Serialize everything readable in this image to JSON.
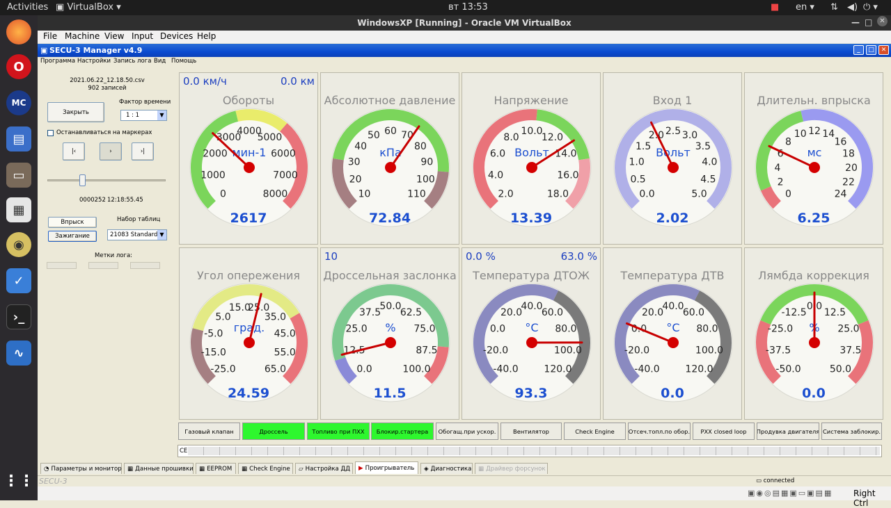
{
  "ubuntu": {
    "activities": "Activities",
    "app_menu": "VirtualBox",
    "clock": "вт 13:53",
    "lang": "en"
  },
  "vbox": {
    "title": "WindowsXP [Running] - Oracle VM VirtualBox",
    "menu": [
      "File",
      "Machine",
      "View",
      "Input",
      "Devices",
      "Help"
    ],
    "host_key": "Right Ctrl"
  },
  "xp": {
    "title": "SECU-3 Manager v4.9",
    "menu": [
      "Программа",
      "Настройки",
      "Запись лога",
      "Вид",
      "Помощь"
    ]
  },
  "left": {
    "file": "2021.06.22_12.18.50.csv",
    "records": "902 записей",
    "close_btn": "Закрыть",
    "time_factor_label": "Фактор времени",
    "time_factor": "1 : 1",
    "stop_markers": "Останавливаться на маркерах",
    "nav": [
      "|<",
      "|>",
      "|>|"
    ],
    "nav_glyphs": [
      "|‹",
      "›",
      "›|"
    ],
    "position": "0000252",
    "time": "12:18:55.45",
    "inject_btn": "Впрыск",
    "ignition_btn": "Зажигание",
    "table_set_label": "Набор таблиц",
    "table_set": "21083 Standard",
    "log_marks": "Метки лога:"
  },
  "gauges": [
    {
      "title": "Обороты",
      "unit": "мин-1",
      "value": "2617",
      "num": 2617,
      "min": 0,
      "max": 8000,
      "ticks": [
        "0",
        "1000",
        "2000",
        "3000",
        "4000",
        "5000",
        "6000",
        "7000",
        "8000"
      ],
      "corner_left": "0.0 км/ч",
      "corner_right": "0.0 км",
      "zones": [
        [
          "#7bd55b",
          0,
          0.45
        ],
        [
          "#e9ec6b",
          0.45,
          0.65
        ],
        [
          "#e9737a",
          0.65,
          1
        ]
      ]
    },
    {
      "title": "Абсолютное давление",
      "unit": "кПа",
      "value": "72.84",
      "num": 72.84,
      "min": 10,
      "max": 110,
      "ticks": [
        "10",
        "20",
        "30",
        "40",
        "50",
        "60",
        "70",
        "80",
        "90",
        "100",
        "110"
      ],
      "zones": [
        [
          "#a57f82",
          0,
          0.2
        ],
        [
          "#7bd55b",
          0.2,
          0.85
        ],
        [
          "#a57f82",
          0.85,
          1
        ]
      ]
    },
    {
      "title": "Напряжение",
      "unit": "Вольт",
      "value": "13.39",
      "num": 13.39,
      "min": 2,
      "max": 18,
      "ticks": [
        "2.0",
        "4.0",
        "6.0",
        "8.0",
        "10.0",
        "12.0",
        "14.0",
        "16.0",
        "18.0"
      ],
      "zones": [
        [
          "#e9737a",
          0,
          0.52
        ],
        [
          "#7bd55b",
          0.52,
          0.8
        ],
        [
          "#f0a0a8",
          0.8,
          1
        ]
      ]
    },
    {
      "title": "Вход 1",
      "unit": "Вольт",
      "value": "2.02",
      "num": 2.02,
      "min": 0,
      "max": 5,
      "ticks": [
        "0.0",
        "0.5",
        "1.0",
        "1.5",
        "2.0",
        "2.5",
        "3.0",
        "3.5",
        "4.0",
        "4.5",
        "5.0"
      ],
      "zones": [
        [
          "#b0b0e8",
          0,
          1
        ]
      ]
    },
    {
      "title": "Длительн. впрыска",
      "unit": "мс",
      "value": "6.25",
      "num": 6.25,
      "min": 0,
      "max": 24,
      "ticks": [
        "0",
        "2",
        "4",
        "6",
        "8",
        "10",
        "12",
        "14",
        "16",
        "18",
        "20",
        "22",
        "24"
      ],
      "zones": [
        [
          "#e9737a",
          0,
          0.08
        ],
        [
          "#7bd55b",
          0.08,
          0.45
        ],
        [
          "#9a9af0",
          0.45,
          1
        ]
      ]
    },
    {
      "title": "Угол опережения",
      "unit": "град.",
      "value": "24.59",
      "num": 24.59,
      "min": -25,
      "max": 65,
      "ticks": [
        "-25.0",
        "-15.0",
        "-5.0",
        "5.0",
        "15.0",
        "25.0",
        "35.0",
        "45.0",
        "55.0",
        "65.0"
      ],
      "zones": [
        [
          "#a57f82",
          0,
          0.22
        ],
        [
          "#e3ea85",
          0.22,
          0.72
        ],
        [
          "#e9737a",
          0.72,
          1
        ]
      ]
    },
    {
      "title": "Дроссельная заслонка",
      "unit": "%",
      "value": "11.5",
      "num": 11.5,
      "min": 0,
      "max": 100,
      "ticks": [
        "0.0",
        "12.5",
        "25.0",
        "37.5",
        "50.0",
        "62.5",
        "75.0",
        "87.5",
        "100.0"
      ],
      "corner_left": "10",
      "zones": [
        [
          "#8a8ad8",
          0,
          0.1
        ],
        [
          "#7cc98f",
          0.1,
          0.85
        ],
        [
          "#e9737a",
          0.85,
          1
        ]
      ]
    },
    {
      "title": "Температура ДТОЖ",
      "unit": "°C",
      "value": "93.3",
      "num": 93.3,
      "min": -40,
      "max": 120,
      "ticks": [
        "-40.0",
        "-20.0",
        "0.0",
        "20.0",
        "40.0",
        "60.0",
        "80.0",
        "100.0",
        "120.0"
      ],
      "corner_left": "0.0 %",
      "corner_right": "63.0 %",
      "zones": [
        [
          "#8a8ac0",
          0,
          0.6
        ],
        [
          "#7a7a7a",
          0.6,
          1
        ]
      ]
    },
    {
      "title": "Температура ДТВ",
      "unit": "°C",
      "value": "0.0",
      "num": 0,
      "min": -40,
      "max": 120,
      "ticks": [
        "-40.0",
        "-20.0",
        "0.0",
        "20.0",
        "40.0",
        "60.0",
        "80.0",
        "100.0",
        "120.0"
      ],
      "zones": [
        [
          "#8a8ac0",
          0,
          0.6
        ],
        [
          "#7a7a7a",
          0.6,
          1
        ]
      ]
    },
    {
      "title": "Лямбда коррекция",
      "unit": "%",
      "value": "0.0",
      "num": 0,
      "min": -50,
      "max": 50,
      "ticks": [
        "-50.0",
        "-37.5",
        "-25.0",
        "-12.5",
        "0.0",
        "12.5",
        "25.0",
        "37.5",
        "50.0"
      ],
      "zones": [
        [
          "#e9737a",
          0,
          0.25
        ],
        [
          "#7bd55b",
          0.25,
          0.75
        ],
        [
          "#e9737a",
          0.75,
          1
        ]
      ]
    }
  ],
  "indicators": [
    {
      "label": "Газовый клапан",
      "on": false
    },
    {
      "label": "Дроссель",
      "on": true
    },
    {
      "label": "Топливо при ПХХ",
      "on": true
    },
    {
      "label": "Блокир.стартера",
      "on": true
    },
    {
      "label": "Обогащ.при ускор.",
      "on": false
    },
    {
      "label": "Вентилятор",
      "on": false
    },
    {
      "label": "Check Engine",
      "on": false
    },
    {
      "label": "Отсеч.топл.по обор.",
      "on": false
    },
    {
      "label": "РХХ closed loop",
      "on": false
    },
    {
      "label": "Продувка двигателя",
      "on": false
    },
    {
      "label": "Система заблокир.",
      "on": false
    }
  ],
  "ce_label": "CE",
  "tabs": [
    "Параметры и монитор",
    "Данные прошивки",
    "EEPROM",
    "Check Engine",
    "Настройка ДД",
    "Проигрыватель",
    "Диагностика",
    "Драйвер форсунок"
  ],
  "status": {
    "left": "SECU-3",
    "right": "connected"
  }
}
